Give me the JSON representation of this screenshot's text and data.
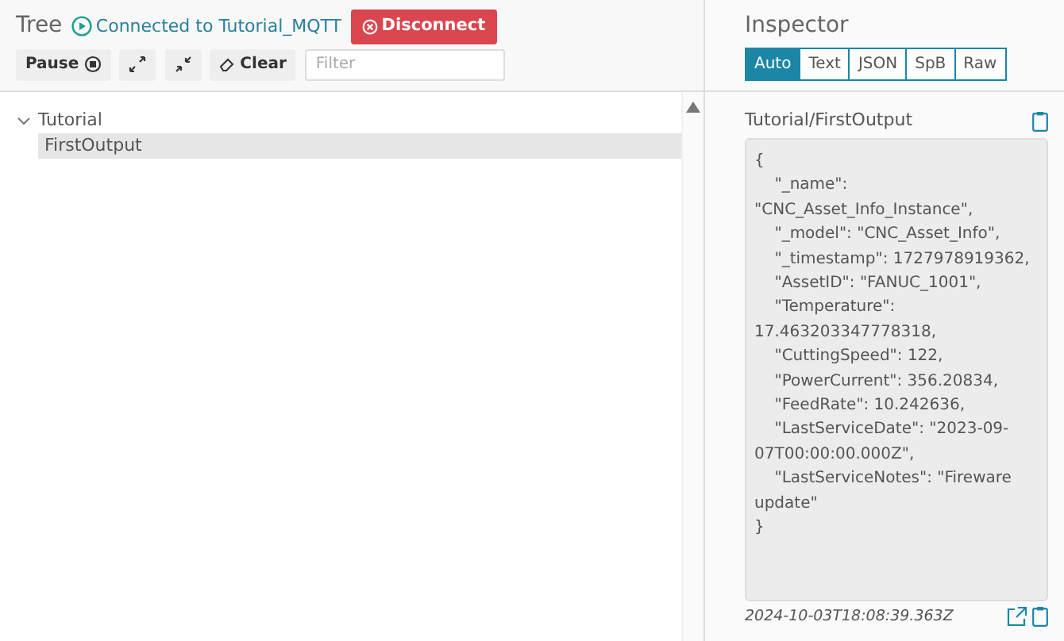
{
  "tree_panel": {
    "title": "Tree",
    "connection": {
      "connected": true,
      "label": "Connected to Tutorial_MQTT"
    },
    "disconnect_button": "Disconnect",
    "toolbar": {
      "pause_button": "Pause",
      "clear_button": "Clear",
      "filter": {
        "placeholder": "Filter"
      }
    },
    "nodes": [
      {
        "label": "Tutorial",
        "expanded": true,
        "selected": false,
        "children": [
          {
            "label": "FirstOutput",
            "selected": true
          }
        ]
      }
    ]
  },
  "inspector": {
    "title": "Inspector",
    "tabs": [
      {
        "label": "Auto",
        "selected": true
      },
      {
        "label": "Text",
        "selected": false
      },
      {
        "label": "JSON",
        "selected": false
      },
      {
        "label": "SpB",
        "selected": false
      },
      {
        "label": "Raw",
        "selected": false
      }
    ],
    "topic": "Tutorial/FirstOutput",
    "payload": "{\n\t\"_name\": \"CNC_Asset_Info_Instance\",\n\t\"_model\": \"CNC_Asset_Info\",\n\t\"_timestamp\": 1727978919362,\n\t\"AssetID\": \"FANUC_1001\",\n\t\"Temperature\": 17.463203347778318,\n\t\"CuttingSpeed\": 122,\n\t\"PowerCurrent\": 356.20834,\n\t\"FeedRate\": 10.242636,\n\t\"LastServiceDate\": \"2023-09-07T00:00:00.000Z\",\n\t\"LastServiceNotes\": \"Fireware update\"\n}",
    "received_at": "2024-10-03T18:08:39.363Z"
  }
}
